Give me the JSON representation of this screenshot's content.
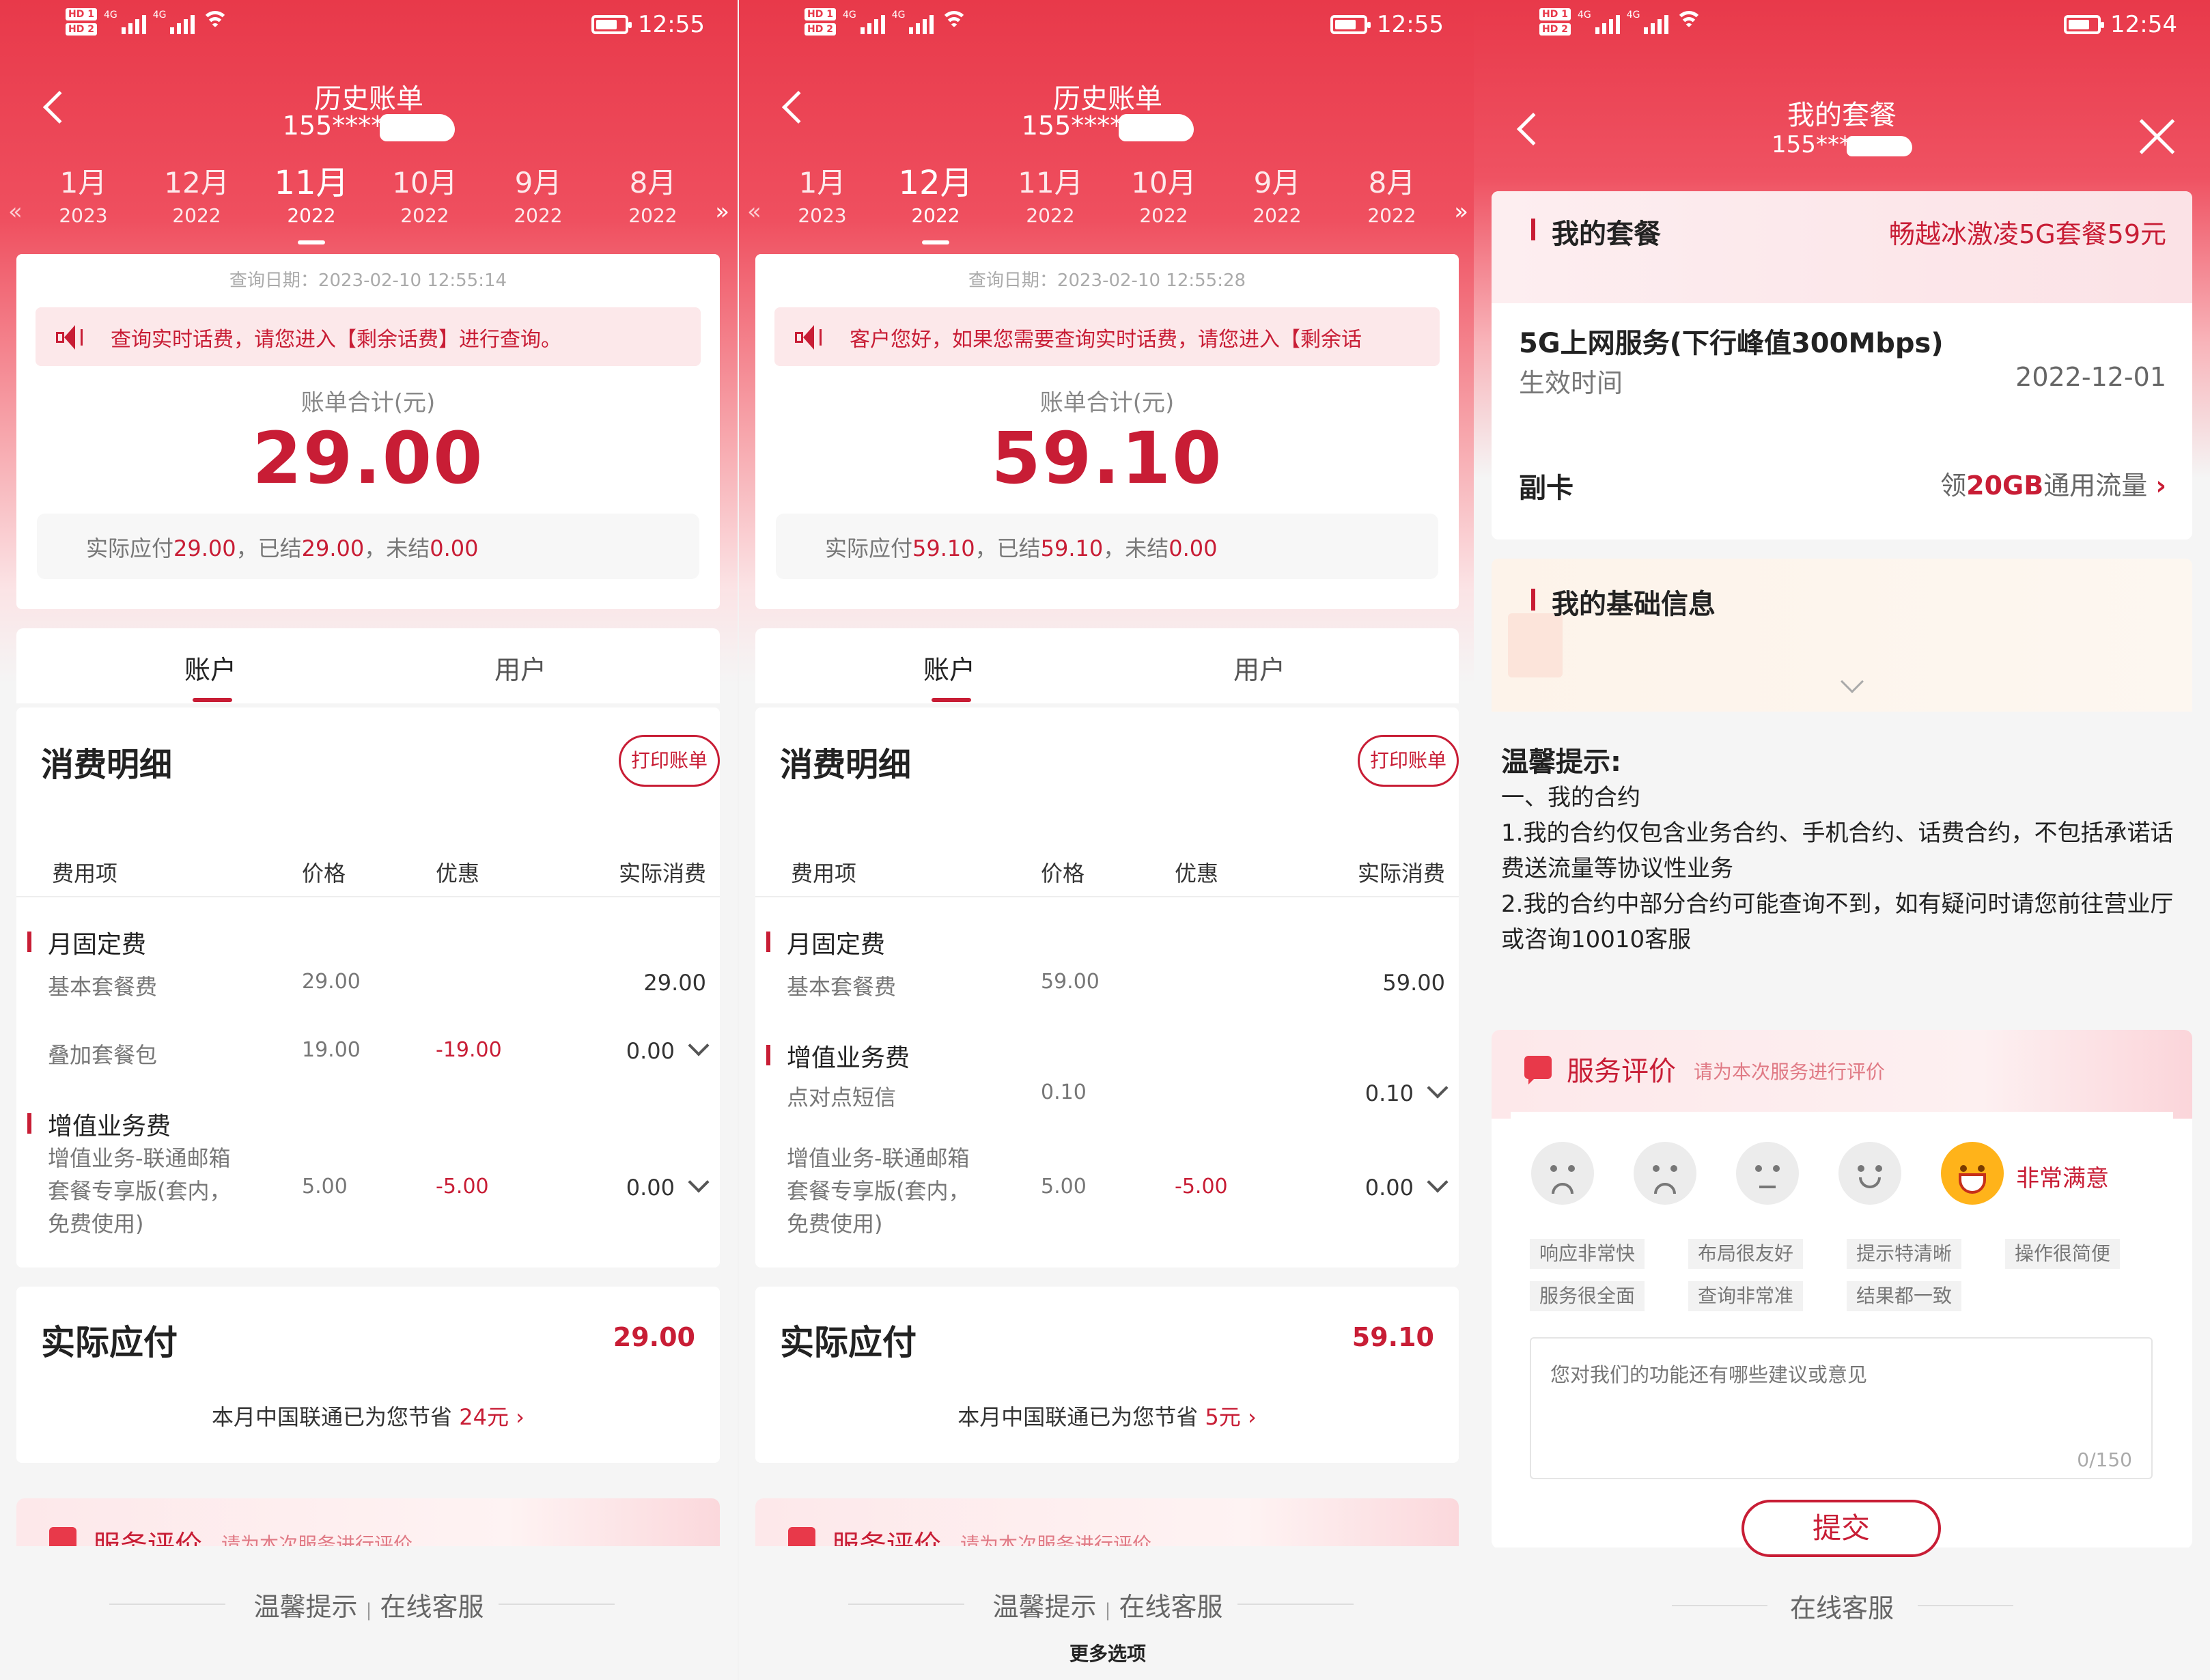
{
  "status": {
    "hd1": "HD 1",
    "hd2": "HD 2",
    "net1": "4G",
    "net2": "4G",
    "time_1": "12:55",
    "time_2": "12:55",
    "time_3": "12:54"
  },
  "screen1": {
    "title": "历史账单",
    "phone": "155****",
    "months": [
      {
        "m": "1月",
        "y": "2023"
      },
      {
        "m": "12月",
        "y": "2022"
      },
      {
        "m": "11月",
        "y": "2022"
      },
      {
        "m": "10月",
        "y": "2022"
      },
      {
        "m": "9月",
        "y": "2022"
      },
      {
        "m": "8月",
        "y": "2022"
      }
    ],
    "selected_month": "11月",
    "query_date": "查询日期：2023-02-10 12:55:14",
    "notice": "查询实时话费，请您进入【剩余话费】进行查询。",
    "total_label": "账单合计(元)",
    "total": "29.00",
    "pay_prefix": "实际应付",
    "pay_due": "29.00",
    "settled_prefix": "，已结",
    "settled": "29.00",
    "unsettled_prefix": "，未结",
    "unsettled": "0.00",
    "tab_account": "账户",
    "tab_user": "用户",
    "detail_title": "消费明细",
    "print_btn": "打印账单",
    "headers": {
      "item": "费用项",
      "price": "价格",
      "discount": "优惠",
      "actual": "实际消费"
    },
    "group1": "月固定费",
    "row1": {
      "item": "基本套餐费",
      "price": "29.00",
      "discount": "",
      "actual": "29.00"
    },
    "row2": {
      "item": "叠加套餐包",
      "price": "19.00",
      "discount": "-19.00",
      "actual": "0.00"
    },
    "group2": "增值业务费",
    "row3": {
      "item_1": "增值业务-联通邮箱",
      "item_2": "套餐专享版(套内，",
      "item_3": "免费使用)",
      "price": "5.00",
      "discount": "-5.00",
      "actual": "0.00"
    },
    "pay_title": "实际应付",
    "pay_value": "29.00",
    "save_text": "本月中国联通已为您节省 ",
    "save_value": "24元",
    "save_arrow": "›",
    "eval_title": "服务评价",
    "eval_sub": "请为本次服务进行评价",
    "footer_tips": "温馨提示",
    "footer_sep": "|",
    "footer_service": "在线客服"
  },
  "screen2": {
    "title": "历史账单",
    "phone": "155****",
    "months": [
      {
        "m": "1月",
        "y": "2023"
      },
      {
        "m": "12月",
        "y": "2022"
      },
      {
        "m": "11月",
        "y": "2022"
      },
      {
        "m": "10月",
        "y": "2022"
      },
      {
        "m": "9月",
        "y": "2022"
      },
      {
        "m": "8月",
        "y": "2022"
      }
    ],
    "selected_month": "12月",
    "query_date": "查询日期：2023-02-10 12:55:28",
    "notice": "客户您好，如果您需要查询实时话费，请您进入【剩余话",
    "total_label": "账单合计(元)",
    "total": "59.10",
    "pay_prefix": "实际应付",
    "pay_due": "59.10",
    "settled_prefix": "，已结",
    "settled": "59.10",
    "unsettled_prefix": "，未结",
    "unsettled": "0.00",
    "tab_account": "账户",
    "tab_user": "用户",
    "detail_title": "消费明细",
    "print_btn": "打印账单",
    "headers": {
      "item": "费用项",
      "price": "价格",
      "discount": "优惠",
      "actual": "实际消费"
    },
    "group1": "月固定费",
    "row1": {
      "item": "基本套餐费",
      "price": "59.00",
      "discount": "",
      "actual": "59.00"
    },
    "group2": "增值业务费",
    "row2": {
      "item": "点对点短信",
      "price": "0.10",
      "discount": "",
      "actual": "0.10"
    },
    "row3": {
      "item_1": "增值业务-联通邮箱",
      "item_2": "套餐专享版(套内，",
      "item_3": "免费使用)",
      "price": "5.00",
      "discount": "-5.00",
      "actual": "0.00"
    },
    "pay_title": "实际应付",
    "pay_value": "59.10",
    "save_text": "本月中国联通已为您节省 ",
    "save_value": "5元",
    "save_arrow": "›",
    "eval_title": "服务评价",
    "eval_sub": "请为本次服务进行评价",
    "footer_tips": "温馨提示",
    "footer_sep": "|",
    "footer_service": "在线客服",
    "more_options": "更多选项"
  },
  "screen3": {
    "title": "我的套餐",
    "phone": "155***",
    "pkg_section": "我的套餐",
    "pkg_name": "畅越冰激凌5G套餐59元",
    "service": "5G上网服务(下行峰值300Mbps)",
    "effective_label": "生效时间",
    "effective_date": "2022-12-01",
    "subcard_label": "副卡",
    "subcard_pre": "领",
    "subcard_highlight": "20GB",
    "subcard_post": "通用流量",
    "subcard_arrow": "›",
    "basic_info": "我的基础信息",
    "tips_title": "温馨提示:",
    "tips_1": "一、我的合约",
    "tips_2": "1.我的合约仅包含业务合约、手机合约、话费合约，不包括承诺话费送流量等协议性业务",
    "tips_3": "2.我的合约中部分合约可能查询不到，如有疑问时请您前往营业厅或咨询10010客服",
    "eval_title": "服务评价",
    "eval_sub": "请为本次服务进行评价",
    "rating_label": "非常满意",
    "rating_selected": 5,
    "tags": [
      "响应非常快",
      "布局很友好",
      "提示特清晰",
      "操作很简便",
      "服务很全面",
      "查询非常准",
      "结果都一致"
    ],
    "feedback_placeholder": "您对我们的功能还有哪些建议或意见",
    "feedback_count": "0/150",
    "submit": "提交",
    "footer_service": "在线客服"
  },
  "colors": {
    "brand": "#c81d35",
    "header": "#e8394a"
  }
}
